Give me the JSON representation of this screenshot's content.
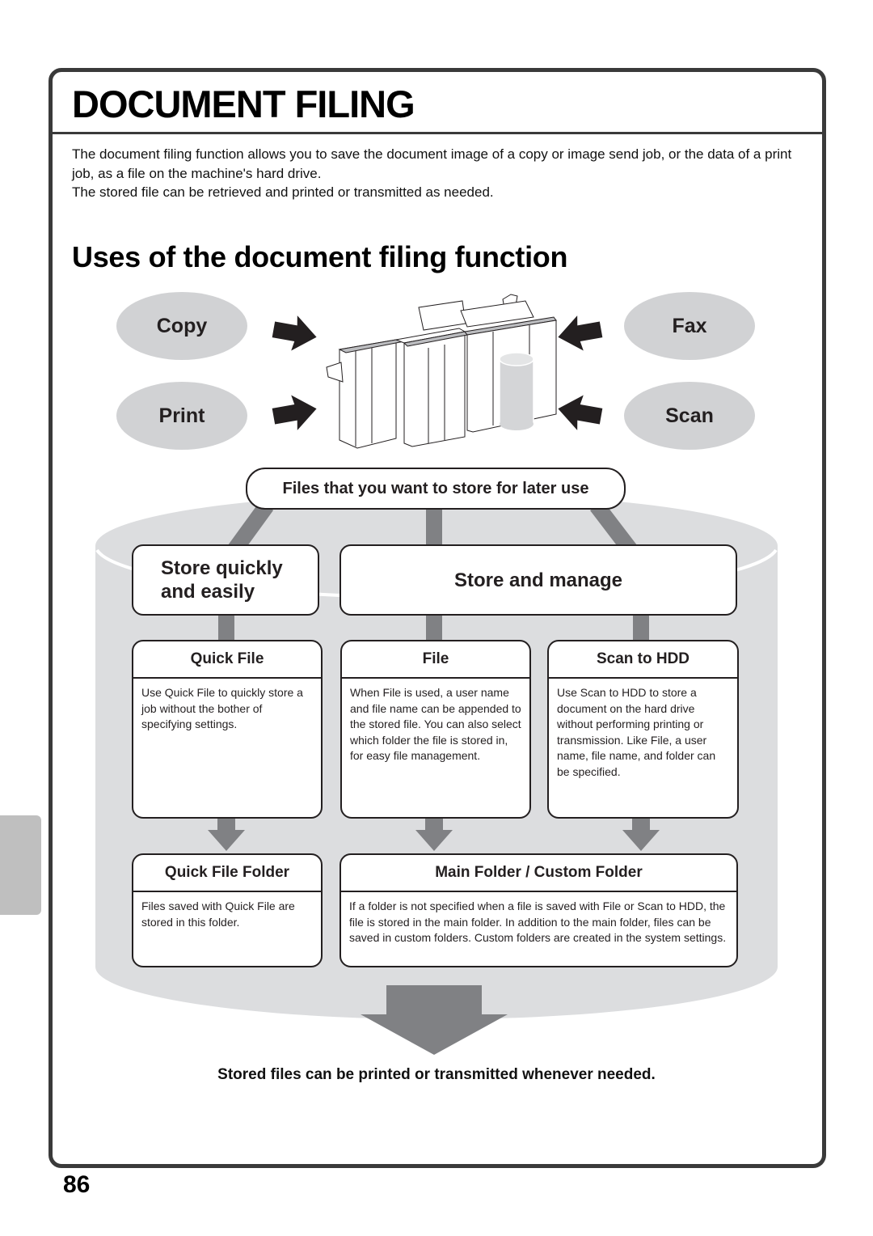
{
  "page": {
    "title": "DOCUMENT FILING",
    "intro": [
      "The document filing function allows you to save the document image of a copy or image send job, or the data of a print job, as a file on the machine's hard drive.",
      "The stored file can be retrieved and printed or transmitted as needed."
    ],
    "subtitle": "Uses of the document filing function",
    "page_number": "86"
  },
  "sources": {
    "copy": "Copy",
    "print": "Print",
    "fax": "Fax",
    "scan": "Scan"
  },
  "diagram": {
    "top_label": "Files that you want to store for later use",
    "categories": {
      "quick": "Store quickly and easily",
      "manage": "Store and manage"
    },
    "modes": [
      {
        "title": "Quick File",
        "body": "Use Quick File to quickly store a job without the bother of specifying settings."
      },
      {
        "title": "File",
        "body": "When File is used, a user name and file name can be appended to the stored file. You can also select which folder the file is stored in, for easy file management."
      },
      {
        "title": "Scan to HDD",
        "body": "Use Scan to HDD to store a document on the hard drive without performing printing or transmission. Like File, a user name, file name, and folder can be specified."
      }
    ],
    "folders": [
      {
        "title": "Quick File Folder",
        "body": "Files saved with Quick File are stored in this folder."
      },
      {
        "title": "Main Folder / Custom Folder",
        "body": "If a folder is not specified when a file is saved with File or Scan to HDD, the file is stored in the main folder. In addition to the main folder, files can be saved in custom folders. Custom folders are created in the system settings."
      }
    ],
    "conclusion": "Stored files can be printed or transmitted whenever needed."
  },
  "colors": {
    "frame": "#3a3a3a",
    "oval_fill": "#d1d2d4",
    "cylinder_fill": "#dcdddf",
    "connector": "#808184",
    "side_tab": "#bfbfbf"
  }
}
